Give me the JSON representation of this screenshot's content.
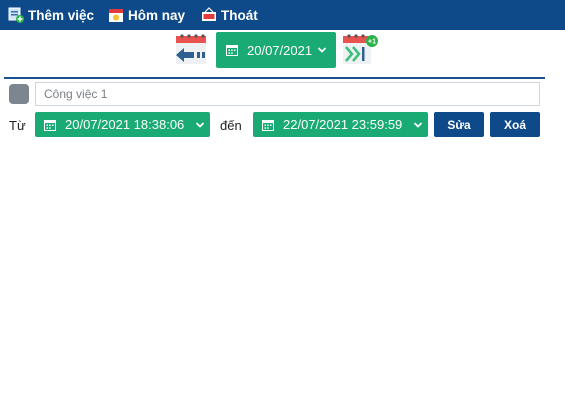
{
  "menu": {
    "add_task": "Thêm việc",
    "today": "Hôm nay",
    "logout": "Thoát"
  },
  "date_nav": {
    "current_date": "20/07/2021",
    "next_badge": "+1"
  },
  "task": {
    "placeholder": "Công việc 1",
    "value": ""
  },
  "range": {
    "from_label": "Từ",
    "start": "20/07/2021 18:38:06",
    "to_label": "đến",
    "end": "22/07/2021 23:59:59"
  },
  "actions": {
    "edit": "Sửa",
    "delete": "Xoá"
  },
  "colors": {
    "topbar": "#0e4a8a",
    "accent_green": "#1aaa74",
    "task_color_swatch": "#7d8591"
  }
}
